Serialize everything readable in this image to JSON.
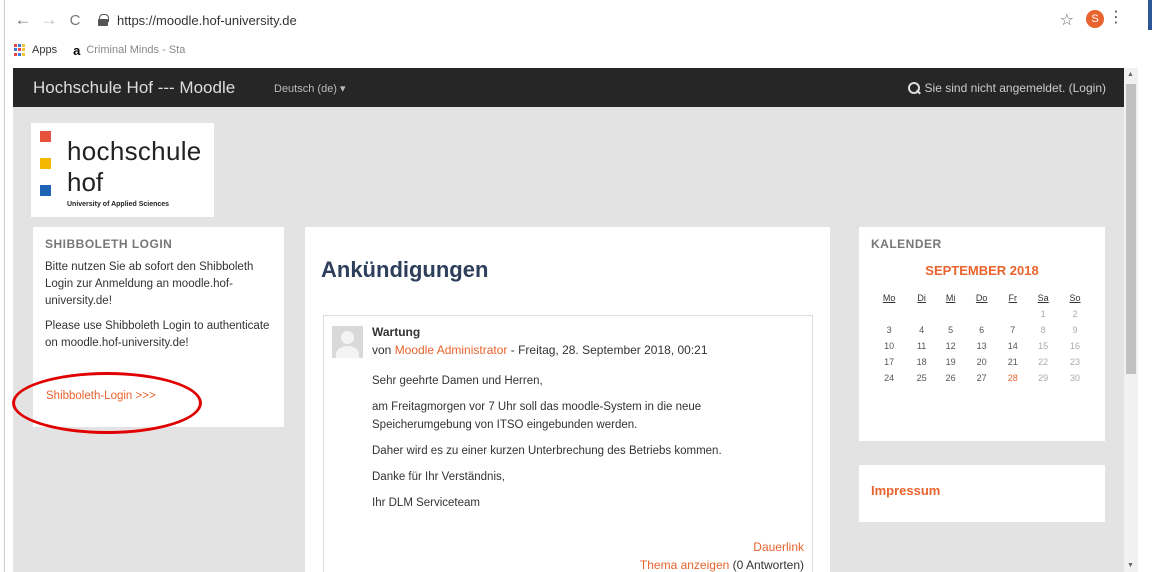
{
  "browser": {
    "url": "https://moodle.hof-university.de",
    "profile_initial": "S",
    "bookmarks": [
      {
        "label": "Apps"
      },
      {
        "label": "Criminal Minds - Sta"
      }
    ]
  },
  "navbar": {
    "brand": "Hochschule Hof --- Moodle",
    "language": "Deutsch (de) ▾",
    "login_status": "Sie sind nicht angemeldet. (Login)"
  },
  "logo": {
    "line1": "hochschule",
    "line2": "hof",
    "tagline": "University of Applied Sciences"
  },
  "shibboleth": {
    "title": "SHIBBOLETH LOGIN",
    "text_de": "Bitte nutzen Sie ab sofort den Shibboleth Login zur Anmeldung an moodle.hof-university.de!",
    "text_en": "Please use Shibboleth Login to authenticate on moodle.hof-university.de!",
    "link": "Shibboleth-Login >>>"
  },
  "main": {
    "heading": "Ankündigungen",
    "post": {
      "subject": "Wartung",
      "by": "von ",
      "author": "Moodle Administrator",
      "date": " - Freitag, 28. September 2018, 00:21",
      "paragraphs": [
        "Sehr geehrte Damen und Herren,",
        "am Freitagmorgen vor 7 Uhr soll das moodle-System in die neue Speicherumgebung von ITSO eingebunden werden.",
        "Daher wird es zu einer kurzen Unterbrechung des Betriebs kommen.",
        "Danke für Ihr Verständnis,",
        "Ihr DLM Serviceteam"
      ],
      "permalink": "Dauerlink",
      "discussion_link": "Thema anzeigen",
      "replies": " (0 Antworten)"
    }
  },
  "calendar": {
    "title": "KALENDER",
    "month": "SEPTEMBER 2018",
    "weekdays": [
      "Mo",
      "Di",
      "Mi",
      "Do",
      "Fr",
      "Sa",
      "So"
    ],
    "weeks": [
      [
        "",
        "",
        "",
        "",
        "",
        "1",
        "2"
      ],
      [
        "3",
        "4",
        "5",
        "6",
        "7",
        "8",
        "9"
      ],
      [
        "10",
        "11",
        "12",
        "13",
        "14",
        "15",
        "16"
      ],
      [
        "17",
        "18",
        "19",
        "20",
        "21",
        "22",
        "23"
      ],
      [
        "24",
        "25",
        "26",
        "27",
        "28",
        "29",
        "30"
      ]
    ],
    "highlight_day": "28"
  },
  "impressum": {
    "link": "Impressum"
  },
  "colors": {
    "accent": "#e8632d",
    "navbar": "#262626",
    "annotation_circle": "#e00000"
  }
}
